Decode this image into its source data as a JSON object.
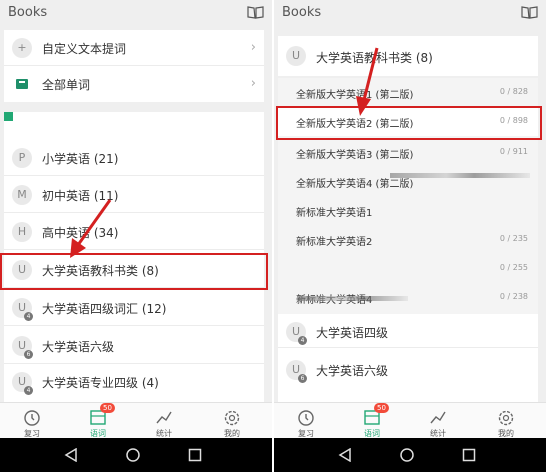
{
  "left": {
    "header": {
      "title": "Books",
      "icon": "book-open-icon"
    },
    "top_rows": [
      {
        "icon": "plus-icon",
        "label": "自定义文本提词"
      },
      {
        "icon": "book-icon",
        "label": "全部单词"
      }
    ],
    "categories": [
      {
        "letter": "P",
        "label": "小学英语 (21)"
      },
      {
        "letter": "M",
        "label": "初中英语 (11)"
      },
      {
        "letter": "H",
        "label": "高中英语 (34)"
      },
      {
        "letter": "U",
        "label": "大学英语教科书类 (8)"
      },
      {
        "letter": "U",
        "label": "大学英语四级词汇 (12)",
        "sub": "4"
      },
      {
        "letter": "U",
        "label": "大学英语六级",
        "sub": "6"
      },
      {
        "letter": "U",
        "label": "大学英语专业四级 (4)",
        "sub": "4"
      }
    ]
  },
  "right": {
    "header": {
      "title": "Books",
      "icon": "book-open-icon"
    },
    "expanded": {
      "letter": "U",
      "label": "大学英语教科书类 (8)"
    },
    "books": [
      {
        "label": "全新版大学英语1 (第二版)",
        "progress": "0 / 828"
      },
      {
        "label": "全新版大学英语2 (第二版)",
        "progress": "0 / 898"
      },
      {
        "label": "全新版大学英语3 (第二版)",
        "progress": "0 / 911"
      },
      {
        "label": "全新版大学英语4 (第二版)",
        "progress": ""
      },
      {
        "label": "新标准大学英语1",
        "progress": ""
      },
      {
        "label": "新标准大学英语2",
        "progress": "0 / 235"
      },
      {
        "label": "",
        "progress": "0 / 255"
      },
      {
        "label": "新标准大学英语4",
        "progress": "0 / 238"
      }
    ],
    "more": [
      {
        "letter": "U",
        "label": "大学英语四级",
        "sub": "4"
      },
      {
        "letter": "U",
        "label": "大学英语六级",
        "sub": "6"
      }
    ]
  },
  "nav": [
    {
      "icon": "clock-icon",
      "label": "复习"
    },
    {
      "icon": "book-stack-icon",
      "label": "语词",
      "badge": "50"
    },
    {
      "icon": "chart-icon",
      "label": "统计"
    },
    {
      "icon": "gear-icon",
      "label": "我的"
    }
  ],
  "colors": {
    "accent": "#21a874",
    "highlight": "#d42020",
    "badge": "#f24b3a"
  }
}
